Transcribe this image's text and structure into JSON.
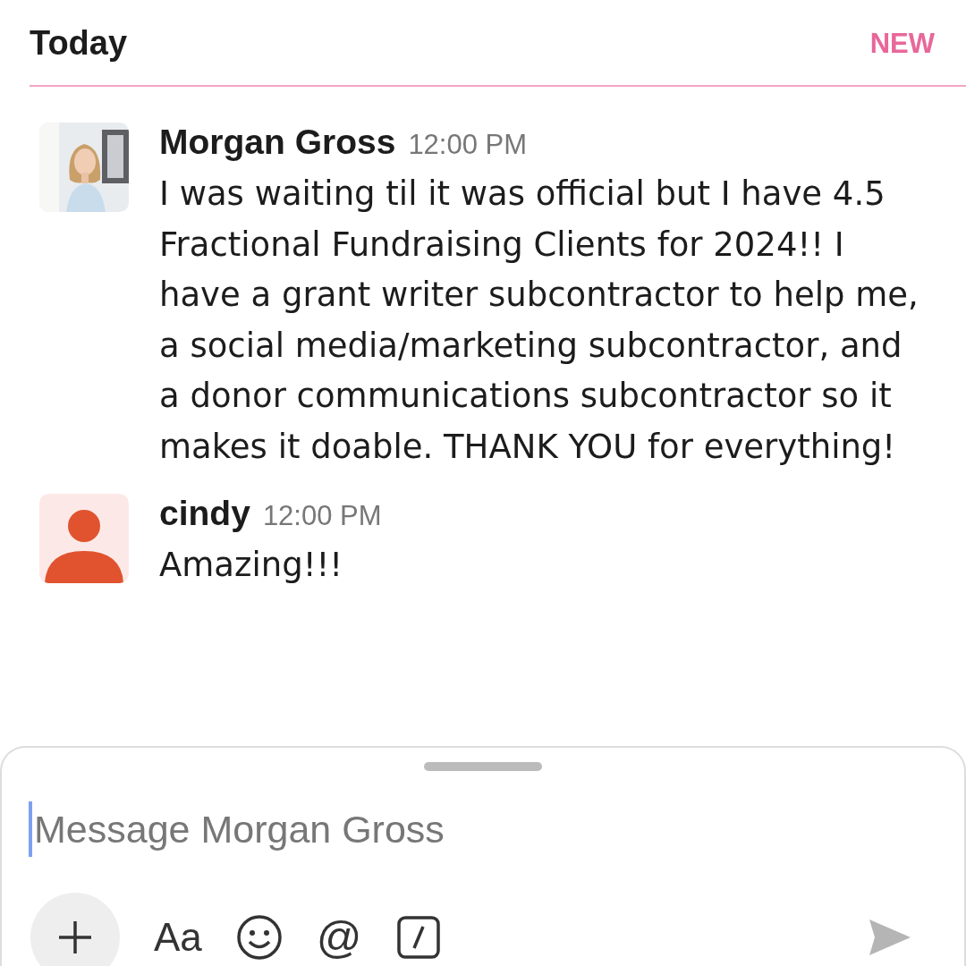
{
  "header": {
    "title": "Today",
    "badge": "NEW"
  },
  "messages": [
    {
      "author": "Morgan Gross",
      "time": "12:00 PM",
      "text": "I was waiting til it was official but I have 4.5 Fractional Fundraising Clients for 2024!! I have a grant writer subcontractor to help me, a social media/marketing subcontractor, and a donor communications subcontractor so it makes it doable. THANK YOU for everything!"
    },
    {
      "author": "cindy",
      "time": "12:00 PM",
      "avatar": {
        "kind": "silhouette"
      },
      "text": "Amazing!!!"
    }
  ],
  "composer": {
    "placeholder": "Message Morgan Gross",
    "format_label": "Aa",
    "mention_label": "@"
  }
}
